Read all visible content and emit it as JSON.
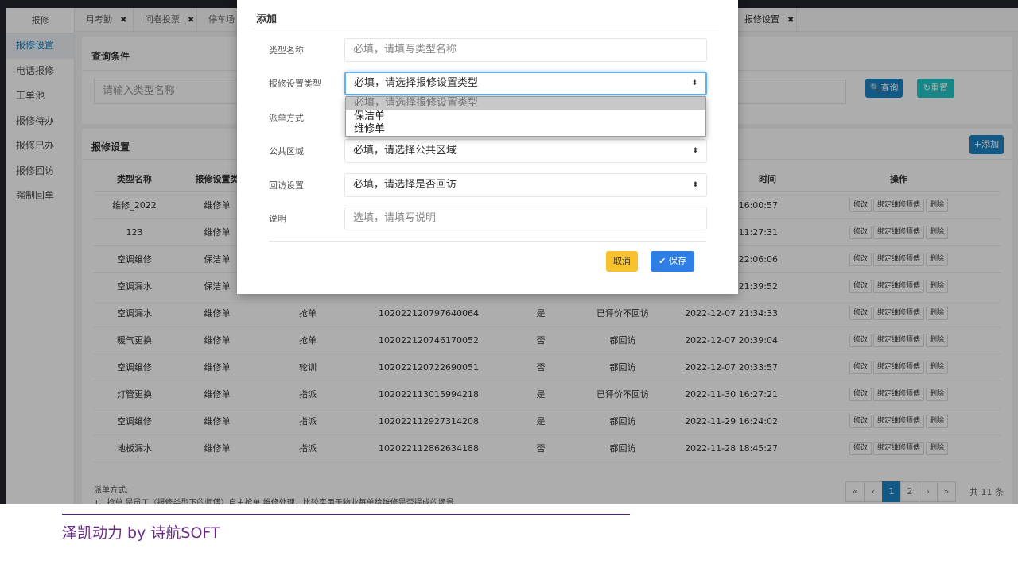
{
  "sidebar": {
    "header": "报修",
    "items": [
      {
        "label": "报修设置",
        "active": true
      },
      {
        "label": "电话报修"
      },
      {
        "label": "工单池"
      },
      {
        "label": "报修待办"
      },
      {
        "label": "报修已办"
      },
      {
        "label": "报修回访"
      },
      {
        "label": "强制回单"
      }
    ]
  },
  "tabs": [
    {
      "label": "月考勤"
    },
    {
      "label": "问卷投票"
    },
    {
      "label": "停车场管"
    },
    {
      "label": "报修设置"
    }
  ],
  "tab_close_glyph": "✖",
  "query_panel": {
    "title": "查询条件",
    "search_placeholder": "请输入类型名称",
    "search_button": "查询",
    "reset_button": "重置"
  },
  "list_panel": {
    "title": "报修设置",
    "add_button": "+添加",
    "headers": [
      "类型名称",
      "报修设置类",
      "",
      "",
      "",
      "",
      "时间",
      "操作"
    ],
    "rows": [
      {
        "name": "维修_2022",
        "type": "维修单",
        "dispatch": "",
        "id": "",
        "revisit": "",
        "revisit_setting": "",
        "time": "-16:00:57"
      },
      {
        "name": "123",
        "type": "维修单",
        "dispatch": "",
        "id": "",
        "revisit": "",
        "revisit_setting": "",
        "time": "11:27:31"
      },
      {
        "name": "空调维修",
        "type": "保洁单",
        "dispatch": "",
        "id": "",
        "revisit": "",
        "revisit_setting": "",
        "time": "22:06:06"
      },
      {
        "name": "空调漏水",
        "type": "保洁单",
        "dispatch": "",
        "id": "",
        "revisit": "",
        "revisit_setting": "",
        "time": "21:39:52"
      },
      {
        "name": "空调漏水",
        "type": "维修单",
        "dispatch": "抢单",
        "id": "102022120797640064",
        "revisit": "是",
        "revisit_setting": "已评价不回访",
        "time": "2022-12-07 21:34:33"
      },
      {
        "name": "暖气更换",
        "type": "维修单",
        "dispatch": "抢单",
        "id": "102022120746170052",
        "revisit": "否",
        "revisit_setting": "都回访",
        "time": "2022-12-07 20:39:04"
      },
      {
        "name": "空调维修",
        "type": "维修单",
        "dispatch": "轮训",
        "id": "102022120722690051",
        "revisit": "否",
        "revisit_setting": "都回访",
        "time": "2022-12-07 20:33:57"
      },
      {
        "name": "灯管更换",
        "type": "维修单",
        "dispatch": "指派",
        "id": "102022113015994218",
        "revisit": "是",
        "revisit_setting": "已评价不回访",
        "time": "2022-11-30 16:27:21"
      },
      {
        "name": "空调维修",
        "type": "维修单",
        "dispatch": "指派",
        "id": "102022112927314208",
        "revisit": "是",
        "revisit_setting": "都回访",
        "time": "2022-11-29 16:24:02"
      },
      {
        "name": "地板漏水",
        "type": "维修单",
        "dispatch": "指派",
        "id": "102022112862634188",
        "revisit": "否",
        "revisit_setting": "都回访",
        "time": "2022-11-28 18:45:27"
      }
    ],
    "op_edit": "修改",
    "op_bind": "绑定维修师傅",
    "op_delete": "删除",
    "note_title": "派单方式:",
    "note_line": "1、抢单 是员工（报修类型下的师傅）自主抢单 维修处理，比较实用于物业每单给维修是否提成的场景",
    "pagination": {
      "first": "«",
      "prev": "‹",
      "pages": [
        "1",
        "2"
      ],
      "next": "›",
      "last": "»",
      "total": "共 11 条"
    }
  },
  "modal": {
    "title": "添加",
    "fields": [
      {
        "label": "类型名称",
        "placeholder": "必填，请填写类型名称"
      },
      {
        "label": "报修设置类型",
        "value": "必填，请选择报修设置类型"
      },
      {
        "label": "派单方式",
        "value": ""
      },
      {
        "label": "公共区域",
        "value": "必填，请选择公共区域"
      },
      {
        "label": "回访设置",
        "value": "必填，请选择是否回访"
      },
      {
        "label": "说明",
        "placeholder": "选填，请填写说明"
      }
    ],
    "dropdown_options": [
      "必填，请选择报修设置类型",
      "保洁单",
      "维修单"
    ],
    "cancel_button": "取消",
    "save_button": "保存",
    "caret": "⬍"
  },
  "colors": {
    "primary": "#1c84c6",
    "reset": "#23c6c8",
    "warning": "#f8ac59",
    "save": "#2f7ee6",
    "footer": "#6a2a86"
  },
  "footer": {
    "text": "泽凯动力 by 诗航SOFT"
  }
}
